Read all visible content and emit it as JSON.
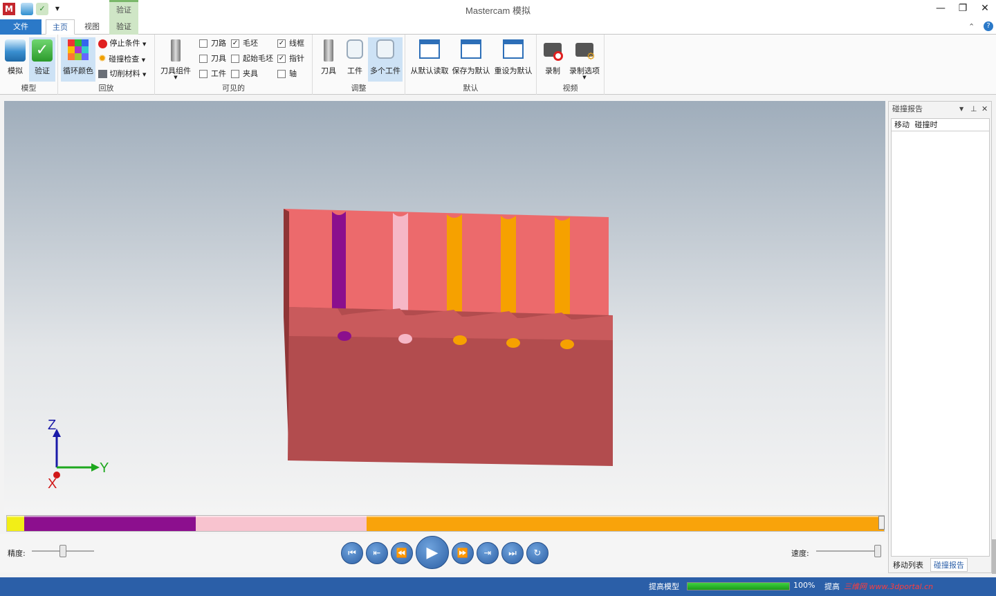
{
  "window": {
    "title": "Mastercam 模拟",
    "context_tab": "验证",
    "controls": [
      "—",
      "❐",
      "✕"
    ]
  },
  "tabs": [
    {
      "label": "文件"
    },
    {
      "label": "主页"
    },
    {
      "label": "视图"
    },
    {
      "label": "验证"
    }
  ],
  "ribbon": {
    "groups": {
      "model": "模型",
      "playback": "回放",
      "visible": "可见的",
      "adjust": "调整",
      "defaults": "默认",
      "video": "视频"
    },
    "buttons": {
      "simulate": "模拟",
      "verify": "验证",
      "cycle_colors": "循环颜色",
      "stop_conditions": "停止条件",
      "collision_check": "碰撞检查",
      "cut_material": "切削材料",
      "tool_assembly": "刀具组件",
      "tool": "刀具",
      "workpiece": "工件",
      "multi_workpiece": "多个工件",
      "load_default": "从默认读取",
      "save_default": "保存为默认",
      "reset_default": "重设为默认",
      "record": "录制",
      "record_options": "录制选项"
    },
    "checkboxes": [
      {
        "label": "刀路",
        "checked": false
      },
      {
        "label": "刀具",
        "checked": false
      },
      {
        "label": "工件",
        "checked": false
      },
      {
        "label": "毛坯",
        "checked": true
      },
      {
        "label": "起始毛坯",
        "checked": false
      },
      {
        "label": "夹具",
        "checked": false
      },
      {
        "label": "线框",
        "checked": true
      },
      {
        "label": "指针",
        "checked": true
      },
      {
        "label": "轴",
        "checked": false
      }
    ]
  },
  "axes": {
    "z": "Z",
    "y": "Y",
    "x": "X"
  },
  "playback": {
    "precision_label": "精度:",
    "speed_label": "速度:",
    "precision_level": 0.5,
    "speed_level": 1.0,
    "buttons": [
      "⏮",
      "⇤",
      "⏪",
      "▶",
      "⏩",
      "⇥",
      "⏭",
      "↻"
    ]
  },
  "timeline": {
    "segments": [
      {
        "color": "#f2ee17",
        "fraction": 0.02
      },
      {
        "color": "#8c0f8e",
        "fraction": 0.195
      },
      {
        "color": "#f8c3cf",
        "fraction": 0.195
      },
      {
        "color": "#f9a30a",
        "fraction": 0.59
      }
    ]
  },
  "panel": {
    "title": "碰撞报告",
    "columns": [
      "移动",
      "碰撞时"
    ],
    "bottom_tabs": [
      "移动列表",
      "碰撞报告"
    ]
  },
  "status": {
    "label": "提高模型",
    "percent_text": "100%",
    "progress": 1.0,
    "label2": "提高",
    "watermark": "三维网 www.3dportal.cn"
  }
}
